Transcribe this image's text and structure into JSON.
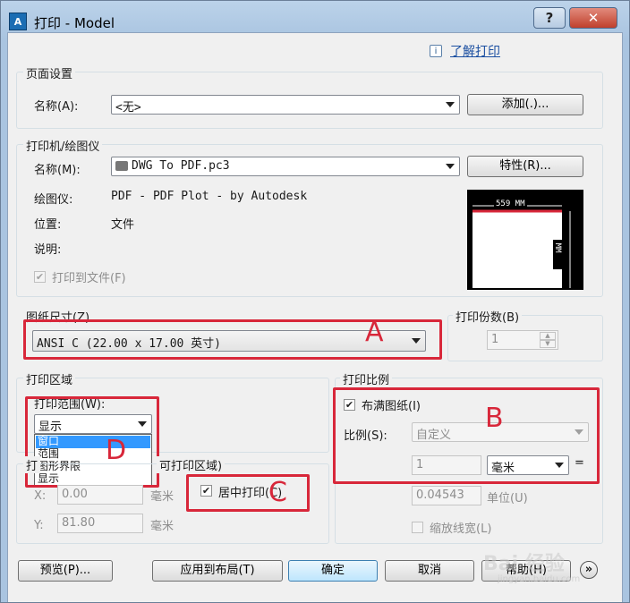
{
  "window": {
    "title": "打印 - Model",
    "app_icon_text": "A",
    "help_glyph": "?",
    "close_glyph": "✕"
  },
  "learn_link": "了解打印",
  "page_setup": {
    "group_label": "页面设置",
    "name_label": "名称(A):",
    "name_value": "<无>",
    "add_button": "添加(.)..."
  },
  "printer": {
    "group_label": "打印机/绘图仪",
    "name_label": "名称(M):",
    "name_value": "DWG To PDF.pc3",
    "properties_button": "特性(R)...",
    "plotter_label": "绘图仪:",
    "plotter_value": "PDF - PDF Plot - by Autodesk",
    "location_label": "位置:",
    "location_value": "文件",
    "description_label": "说明:",
    "plot_to_file_label": "打印到文件(F)",
    "plot_to_file_checked": true,
    "preview_width": "559 MM",
    "preview_height": "432 MM"
  },
  "paper_size": {
    "group_label": "图纸尺寸(Z)",
    "value": "ANSI C (22.00 x 17.00 英寸)"
  },
  "copies": {
    "label": "打印份数(B)",
    "value": "1"
  },
  "plot_area": {
    "group_label": "打印区域",
    "what_label": "打印范围(W):",
    "what_value": "显示",
    "options": [
      "窗口",
      "范围",
      "图形界限",
      "显示"
    ],
    "highlighted_option": "窗口"
  },
  "plot_offset": {
    "group_label_start": "打",
    "group_label_end": "可打印区域)",
    "x_label": "X:",
    "x_value": "0.00",
    "y_label": "Y:",
    "y_value": "81.80",
    "unit_x": "毫米",
    "unit_y": "毫米",
    "center_label": "居中打印(C)",
    "center_checked": true
  },
  "plot_scale": {
    "group_label": "打印比例",
    "fit_label": "布满图纸(I)",
    "fit_checked": true,
    "scale_label": "比例(S):",
    "scale_value": "自定义",
    "numerator": "1",
    "unit_value": "毫米",
    "equals": "=",
    "denominator": "0.04543",
    "units_label": "单位(U)",
    "lineweight_label": "缩放线宽(L)"
  },
  "annotations": {
    "a": "A",
    "b": "B",
    "c": "C",
    "d": "D",
    "color": "#d8273a"
  },
  "buttons": {
    "preview": "预览(P)...",
    "apply_layout": "应用到布局(T)",
    "ok": "确定",
    "cancel": "取消",
    "help": "帮助(H)",
    "expand_glyph": "»"
  },
  "watermark": {
    "text": "Bai 经验",
    "sub": "jingyan.baidu.com"
  }
}
